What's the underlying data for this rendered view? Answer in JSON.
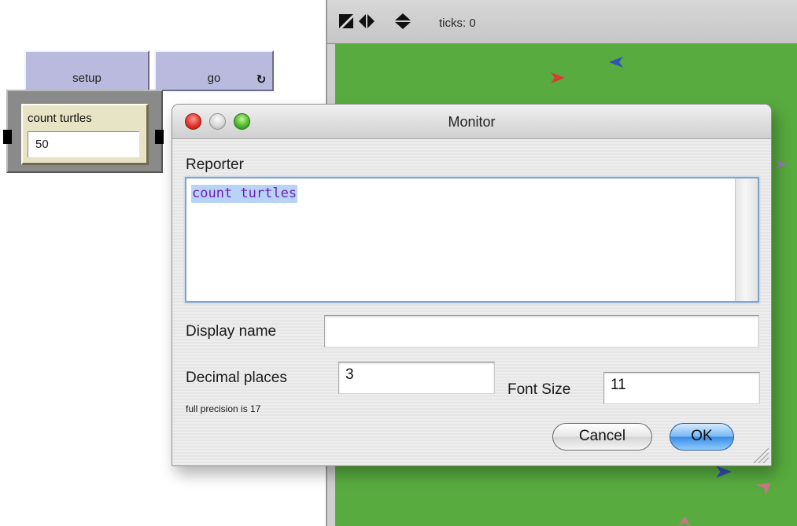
{
  "interface": {
    "setup_button": {
      "label": "setup"
    },
    "go_button": {
      "label": "go",
      "forever_icon": "forever-loop-icon"
    },
    "monitor_widget": {
      "label": "count turtles",
      "value": "50"
    }
  },
  "view": {
    "toolbar_icons": [
      "shape-toggle-icon",
      "horizontal-arrows-icon",
      "vertical-arrows-icon"
    ],
    "ticks_label": "ticks: 0",
    "background_color": "#58ab3f",
    "turtle_colors": [
      "#d93a2f",
      "#3054b5",
      "#9a7cb0",
      "#2f4fae",
      "#c47a84"
    ]
  },
  "dialog": {
    "title": "Monitor",
    "window_controls": [
      "close-button",
      "minimize-button",
      "zoom-button"
    ],
    "reporter": {
      "label": "Reporter",
      "value": "count turtles"
    },
    "display_name": {
      "label": "Display name",
      "value": ""
    },
    "decimal_places": {
      "label": "Decimal places",
      "value": "3",
      "note": "full precision is 17"
    },
    "font_size": {
      "label": "Font Size",
      "value": "11"
    },
    "cancel_label": "Cancel",
    "ok_label": "OK"
  }
}
